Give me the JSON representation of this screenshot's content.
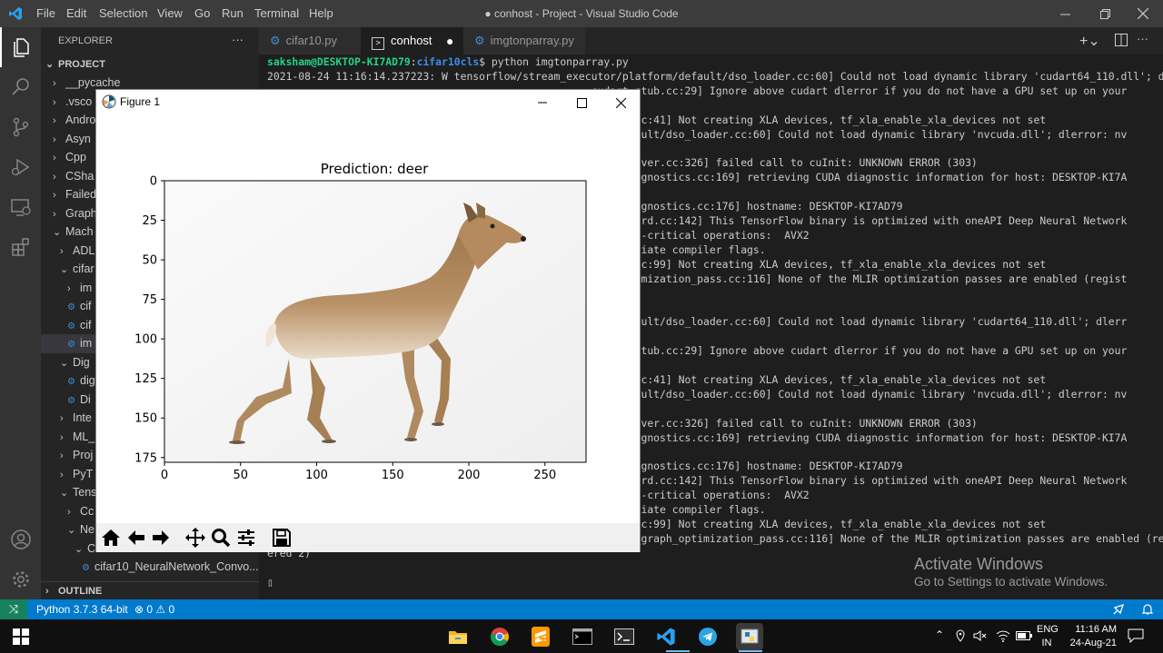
{
  "titlebar": {
    "menus": [
      "File",
      "Edit",
      "Selection",
      "View",
      "Go",
      "Run",
      "Terminal",
      "Help"
    ],
    "title": "● conhost - Project - Visual Studio Code"
  },
  "sidebar": {
    "header": "EXPLORER",
    "more": "···",
    "project": "PROJECT",
    "items": [
      {
        "label": "__pycache",
        "chev": "›",
        "indent": 1
      },
      {
        "label": ".vsco",
        "chev": "›",
        "indent": 1
      },
      {
        "label": "Andro",
        "chev": "›",
        "indent": 1
      },
      {
        "label": "Asyn",
        "chev": "›",
        "indent": 1
      },
      {
        "label": "Cpp",
        "chev": "›",
        "indent": 1
      },
      {
        "label": "CSha",
        "chev": "›",
        "indent": 1
      },
      {
        "label": "Failed",
        "chev": "›",
        "indent": 1
      },
      {
        "label": "Graph",
        "chev": "›",
        "indent": 1
      },
      {
        "label": "Mach",
        "chev": "⌄",
        "indent": 1
      },
      {
        "label": "ADL",
        "chev": "›",
        "indent": 2
      },
      {
        "label": "cifar",
        "chev": "⌄",
        "indent": 2
      },
      {
        "label": "im",
        "chev": "›",
        "indent": 3
      },
      {
        "label": "cif",
        "chev": "",
        "indent": 3
      },
      {
        "label": "cif",
        "chev": "",
        "indent": 3
      },
      {
        "label": "im",
        "chev": "",
        "indent": 3
      },
      {
        "label": "Dig",
        "chev": "⌄",
        "indent": 2
      },
      {
        "label": "dig",
        "chev": "",
        "indent": 3
      },
      {
        "label": "Di",
        "chev": "",
        "indent": 3
      },
      {
        "label": "Inte",
        "chev": "›",
        "indent": 2
      },
      {
        "label": "ML_",
        "chev": "›",
        "indent": 2
      },
      {
        "label": "Proj",
        "chev": "›",
        "indent": 2
      },
      {
        "label": "PyT",
        "chev": "›",
        "indent": 2
      },
      {
        "label": "Tens",
        "chev": "⌄",
        "indent": 2
      },
      {
        "label": "Cc",
        "chev": "›",
        "indent": 3
      },
      {
        "label": "Ne",
        "chev": "⌄",
        "indent": 3
      },
      {
        "label": "CNN",
        "chev": "⌄",
        "indent": 4
      },
      {
        "label": "cifar10_NeuralNetwork_Convo...",
        "chev": "",
        "indent": 5
      }
    ],
    "outline": "OUTLINE"
  },
  "tabs": [
    {
      "label": "cifar10.py"
    },
    {
      "label": "conhost"
    },
    {
      "label": "imgtonparray.py"
    }
  ],
  "terminal": {
    "prompt_user": "saksham@DESKTOP-KI7AD79",
    "prompt_path": "cifar10cls",
    "prompt_cmd": "$ python imgtonparray.py",
    "lines": [
      "2021-08-24 11:16:14.237223: W tensorflow/stream_executor/platform/default/dso_loader.cc:60] Could not load dynamic library 'cudart64_110.dll'; dlerr",
      "                                                    cudart_stub.cc:29] Ignore above cudart dlerror if you do not have a GPU set up on your",
      "",
      "                                                    device.cc:41] Not creating XLA devices, tf_xla_enable_xla_devices not set",
      "                                                    orm/default/dso_loader.cc:60] Could not load dynamic library 'nvcuda.dll'; dlerror: nv",
      "",
      "                                                    cuda_driver.cc:326] failed call to cuInit: UNKNOWN ERROR (303)",
      "                                                    cuda_diagnostics.cc:169] retrieving CUDA diagnostic information for host: DESKTOP-KI7A",
      "",
      "                                                    cuda_diagnostics.cc:176] hostname: DESKTOP-KI7AD79",
      "                                                    cure_guard.cc:142] This TensorFlow binary is optimized with oneAPI Deep Neural Network",
      "                                                    formance-critical operations:  AVX2",
      "                                                     appropriate compiler flags.",
      "                                                    device.cc:99] Not creating XLA devices, tf_xla_enable_xla_devices not set",
      "                                                    aph_optimization_pass.cc:116] None of the MLIR optimization passes are enabled (regist",
      "",
      "",
      "                                                    orm/default/dso_loader.cc:60] Could not load dynamic library 'cudart64_110.dll'; dlerr",
      "",
      "                                                    cudart_stub.cc:29] Ignore above cudart dlerror if you do not have a GPU set up on your",
      "",
      "                                                    device.cc:41] Not creating XLA devices, tf_xla_enable_xla_devices not set",
      "                                                    orm/default/dso_loader.cc:60] Could not load dynamic library 'nvcuda.dll'; dlerror: nv",
      "",
      "                                                    cuda_driver.cc:326] failed call to cuInit: UNKNOWN ERROR (303)",
      "                                                    cuda_diagnostics.cc:169] retrieving CUDA diagnostic information for host: DESKTOP-KI7A",
      "",
      "                                                    cuda_diagnostics.cc:176] hostname: DESKTOP-KI7AD79",
      "                                                    cure_guard.cc:142] This TensorFlow binary is optimized with oneAPI Deep Neural Network",
      "                                                    formance-critical operations:  AVX2",
      "                                                     appropriate compiler flags.",
      "                                                    device.cc:99] Not creating XLA devices, tf_xla_enable_xla_devices not set",
      "2021-08-24 11:16:36.707985: I tensorflow/compiler/mlir/mlir_graph_optimization_pass.cc:116] None of the MLIR optimization passes are enabled (regist",
      "ered 2)"
    ],
    "cursor": "▯"
  },
  "watermark": {
    "line1": "Activate Windows",
    "line2": "Go to Settings to activate Windows."
  },
  "statusbar": {
    "remote": "⤨",
    "python": "Python 3.7.3 64-bit",
    "problems": "⊗ 0 ⚠ 0"
  },
  "taskbar": {
    "lang": "ENG",
    "region": "IN",
    "time": "11:16 AM",
    "date": "24-Aug-21"
  },
  "figure": {
    "window_title": "Figure 1",
    "chart_data": {
      "type": "image",
      "title": "Prediction: deer",
      "xticks": [
        0,
        50,
        100,
        150,
        200,
        250
      ],
      "yticks": [
        0,
        25,
        50,
        75,
        100,
        125,
        150,
        175
      ],
      "xlim": [
        0,
        277
      ],
      "ylim": [
        178,
        0
      ]
    }
  }
}
